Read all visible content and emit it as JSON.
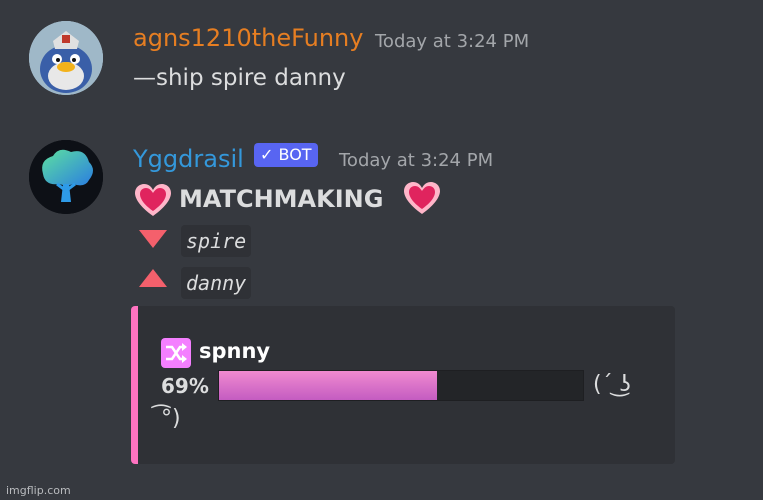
{
  "messages": [
    {
      "author": "agns1210theFunny",
      "author_color": "#e67e22",
      "timestamp": "Today at 3:24 PM",
      "content": "—ship spire danny",
      "avatar_icon": "penguin-avatar"
    },
    {
      "author": "Yggdrasil",
      "author_color": "#3498db",
      "bot_tag": "BOT",
      "bot_check": "✓",
      "timestamp": "Today at 3:24 PM",
      "avatar_icon": "tree-avatar",
      "title": "MATCHMAKING",
      "pair": [
        {
          "icon": "down-triangle-icon",
          "name": "spire"
        },
        {
          "icon": "up-triangle-icon",
          "name": "danny"
        }
      ],
      "embed": {
        "accent_color": "#ff73c1",
        "icon": "shuffle-icon",
        "ship_name": "spnny",
        "percent_label": "69%",
        "percent_value": 0.6,
        "kaomoji_right": "(´ ͜ʖ",
        "kaomoji_left": "͡°)"
      }
    }
  ],
  "watermark": "imgflip.com"
}
